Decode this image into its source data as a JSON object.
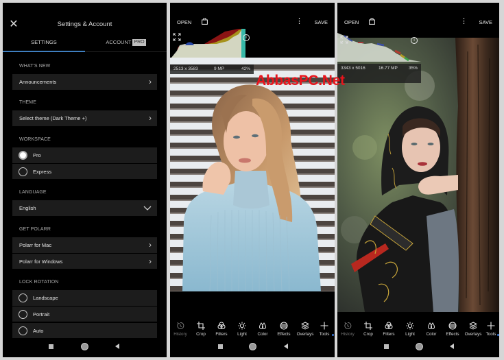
{
  "settings": {
    "title": "Settings & Account",
    "close_icon": "close-icon",
    "tabs": [
      {
        "label": "SETTINGS",
        "active": true
      },
      {
        "label": "ACCOUNT",
        "badge": "PRO",
        "active": false
      }
    ],
    "sections": {
      "whats_new": {
        "title": "WHAT'S NEW",
        "items": [
          "Announcements"
        ]
      },
      "theme": {
        "title": "THEME",
        "items": [
          "Select theme (Dark Theme +)"
        ]
      },
      "workspace": {
        "title": "WORKSPACE",
        "options": [
          "Pro",
          "Express"
        ],
        "selected": "Pro"
      },
      "language": {
        "title": "LANGUAGE",
        "value": "English"
      },
      "get_polarr": {
        "title": "GET POLARR",
        "items": [
          "Polarr for Mac",
          "Polarr for Windows"
        ]
      },
      "lock_rotation": {
        "title": "LOCK ROTATION",
        "options": [
          "Landscape",
          "Portrait",
          "Auto"
        ],
        "selected": null
      }
    }
  },
  "editor": {
    "open_label": "OPEN",
    "save_label": "SAVE",
    "tools": [
      "History",
      "Crop",
      "Filters",
      "Light",
      "Color",
      "Effects",
      "Overlays",
      "Tools"
    ],
    "accent": "#3a78d8"
  },
  "editor_left": {
    "dimensions": "2513 x 3583",
    "megapixels": "9 MP",
    "zoom": "42%",
    "photo": "woman in light blue turtleneck in front of striped shutter"
  },
  "editor_right": {
    "dimensions": "3343 x 5016",
    "megapixels": "16.77 MP",
    "zoom": "35%",
    "photo": "woman in patterned headscarf leaning on tree trunk"
  },
  "watermark": "AbbasPC.Net",
  "nav": [
    "recents-square",
    "home-circle",
    "back-triangle"
  ]
}
